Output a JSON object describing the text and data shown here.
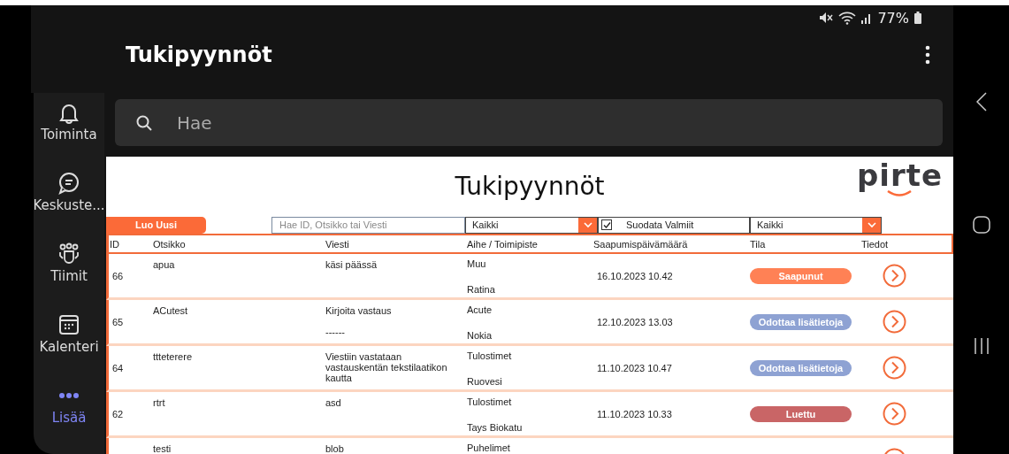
{
  "status_bar": {
    "battery_text": "77%"
  },
  "header": {
    "title": "Tukipyynnöt"
  },
  "sidebar": {
    "items": [
      {
        "kind": "bell",
        "label": "Toiminta",
        "selected": false
      },
      {
        "kind": "chat",
        "label": "Keskuste...",
        "selected": false
      },
      {
        "kind": "teams",
        "label": "Tiimit",
        "selected": false
      },
      {
        "kind": "calendar",
        "label": "Kalenteri",
        "selected": false
      },
      {
        "kind": "more",
        "label": "Lisää",
        "selected": true
      }
    ]
  },
  "search": {
    "placeholder": "Hae"
  },
  "page": {
    "title": "Tukipyynnöt",
    "logo": "pirte",
    "toolbar": {
      "new_button": "Luo Uusi",
      "search_placeholder": "Hae ID, Otsikko tai Viesti",
      "topic_filter": "Kaikki",
      "filter_done": {
        "label": "Suodata Valmiit",
        "checked": true
      },
      "status_filter": "Kaikki"
    },
    "table": {
      "columns": [
        "ID",
        "Otsikko",
        "Viesti",
        "Aihe / Toimipiste",
        "Saapumispäivämäärä",
        "Tila",
        "Tiedot"
      ],
      "rows": [
        {
          "id": "66",
          "title": "apua",
          "message": "käsi päässä",
          "topic": "Muu",
          "location": "Ratina",
          "date": "16.10.2023 10.42",
          "status": {
            "label": "Saapunut",
            "color": "#ff8155"
          }
        },
        {
          "id": "65",
          "title": "ACutest",
          "message": "Kirjoita vastaus\n\n------",
          "topic": "Acute",
          "location": "Nokia",
          "date": "12.10.2023 13.03",
          "status": {
            "label": "Odottaa lisätietoja",
            "color": "#8ea2d3"
          }
        },
        {
          "id": "64",
          "title": "ttteterere",
          "message": "Viestiin vastataan vastauskentän tekstilaatikon kautta",
          "topic": "Tulostimet",
          "location": "Ruovesi",
          "date": "11.10.2023 10.47",
          "status": {
            "label": "Odottaa lisätietoja",
            "color": "#8ea2d3"
          }
        },
        {
          "id": "62",
          "title": "rtrt",
          "message": "asd",
          "topic": "Tulostimet",
          "location": "Tays Biokatu",
          "date": "11.10.2023 10.33",
          "status": {
            "label": "Luettu",
            "color": "#c96566"
          }
        },
        {
          "title": "testi",
          "message": "blob",
          "topic": "Puhelimet"
        }
      ]
    }
  }
}
